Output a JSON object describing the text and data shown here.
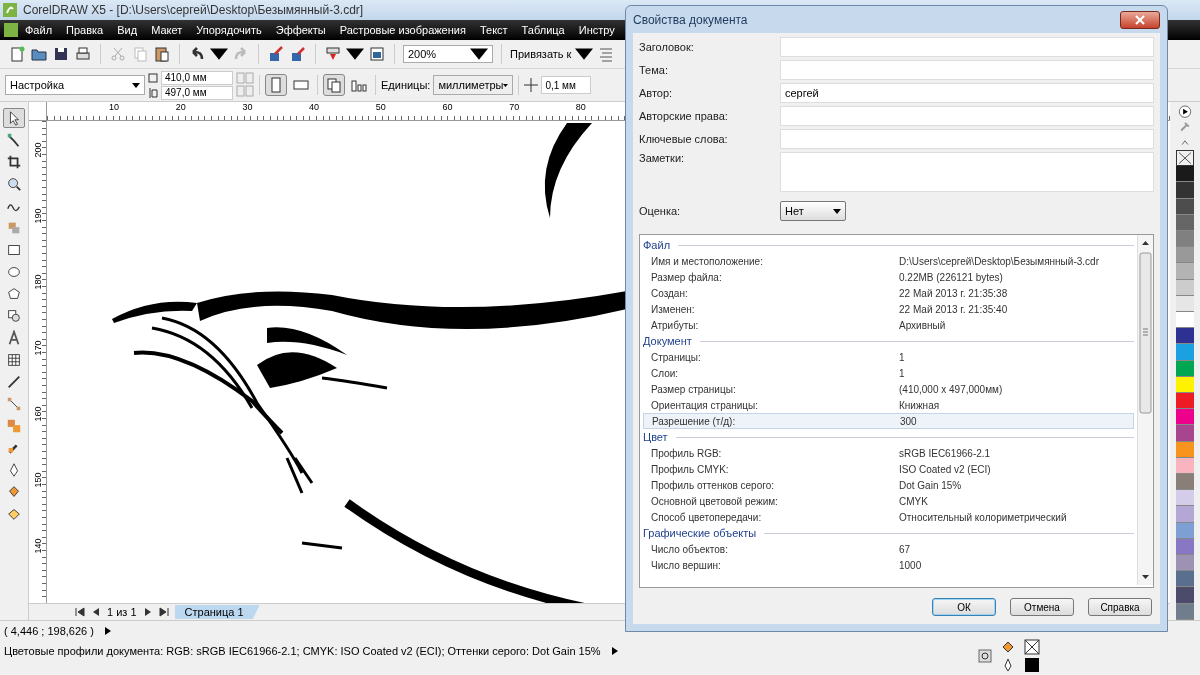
{
  "window": {
    "title": "CorelDRAW X5 - [D:\\Users\\сергей\\Desktop\\Безымянный-3.cdr]"
  },
  "menu": [
    "Файл",
    "Правка",
    "Вид",
    "Макет",
    "Упорядочить",
    "Эффекты",
    "Растровые изображения",
    "Текст",
    "Таблица",
    "Инстру"
  ],
  "toolbar": {
    "zoom": "200%",
    "snap": "Привязать к"
  },
  "property_bar": {
    "preset": "Настройка",
    "width": "410,0 мм",
    "height": "497,0 мм",
    "orientation": [
      {
        "kind": "portrait",
        "selected": true
      },
      {
        "kind": "landscape",
        "selected": false
      }
    ],
    "page_scope": [
      {
        "kind": "all-pages",
        "selected": true
      },
      {
        "kind": "current-page",
        "selected": false
      }
    ],
    "units_label": "Единицы:",
    "units": "миллиметры",
    "nudge": "0,1 мм"
  },
  "toolbox": [
    {
      "kind": "pick",
      "selected": true
    },
    {
      "kind": "shape",
      "selected": false
    },
    {
      "kind": "crop",
      "selected": false
    },
    {
      "kind": "zoom",
      "selected": false
    },
    {
      "kind": "freehand",
      "selected": false
    },
    {
      "kind": "smart",
      "selected": false
    },
    {
      "kind": "rectangle",
      "selected": false
    },
    {
      "kind": "ellipse",
      "selected": false
    },
    {
      "kind": "polygon",
      "selected": false
    },
    {
      "kind": "shapes",
      "selected": false
    },
    {
      "kind": "text",
      "selected": false
    },
    {
      "kind": "table",
      "selected": false
    },
    {
      "kind": "dimension",
      "selected": false
    },
    {
      "kind": "connector",
      "selected": false
    },
    {
      "kind": "blend",
      "selected": false
    },
    {
      "kind": "eyedropper",
      "selected": false
    },
    {
      "kind": "outline",
      "selected": false
    },
    {
      "kind": "fill",
      "selected": false
    },
    {
      "kind": "interactive-fill",
      "selected": false
    }
  ],
  "ruler": {
    "horizontal": [
      "10",
      "20",
      "30",
      "40",
      "50",
      "60",
      "70",
      "80"
    ],
    "vertical": [
      "200",
      "190",
      "180",
      "170",
      "160",
      "150",
      "140"
    ]
  },
  "pages": {
    "counter": "1 из 1",
    "tabs": [
      {
        "label": "Страница 1",
        "selected": true
      }
    ]
  },
  "status_bar": {
    "coordinates": "( 4,446 ; 198,626 )",
    "profiles": "Цветовые профили документа: RGB: sRGB IEC61966-2.1; CMYK: ISO Coated v2 (ECI); Оттенки серого: Dot Gain 15%"
  },
  "palette": [
    {
      "color": "#1a1a1a"
    },
    {
      "color": "#333333"
    },
    {
      "color": "#4d4d4d"
    },
    {
      "color": "#666666"
    },
    {
      "color": "#808080"
    },
    {
      "color": "#999999"
    },
    {
      "color": "#b3b3b3"
    },
    {
      "color": "#cccccc"
    },
    {
      "color": "#e6e6e6"
    },
    {
      "color": "#ffffff"
    },
    {
      "color": "#2e3192"
    },
    {
      "color": "#1ba1e2"
    },
    {
      "color": "#00a651"
    },
    {
      "color": "#fff200"
    },
    {
      "color": "#ed1c24"
    },
    {
      "color": "#ec008c"
    },
    {
      "color": "#a8458f"
    },
    {
      "color": "#f7941d"
    },
    {
      "color": "#f9b4c0"
    },
    {
      "color": "#8a7f78"
    },
    {
      "color": "#d3cdea"
    },
    {
      "color": "#b4a7d6"
    },
    {
      "color": "#7d9fd3"
    },
    {
      "color": "#8878c3"
    },
    {
      "color": "#9e92b4"
    },
    {
      "color": "#5a6f8e"
    },
    {
      "color": "#4c4b6b"
    },
    {
      "color": "#6f7d8c"
    }
  ],
  "dialog": {
    "title": "Свойства документа",
    "fields": [
      {
        "kind": "text",
        "label": "Заголовок:"
      },
      {
        "kind": "text",
        "label": "Тема:"
      },
      {
        "kind": "text",
        "label": "Автор:",
        "value": "сергей"
      },
      {
        "kind": "text",
        "label": "Авторские права:"
      },
      {
        "kind": "text",
        "label": "Ключевые слова:"
      },
      {
        "kind": "multiline",
        "label": "Заметки:"
      },
      {
        "kind": "select",
        "label": "Оценка:",
        "value": "Нет"
      }
    ],
    "sections": [
      {
        "title": "Файл",
        "rows": [
          {
            "label": "Имя и местоположение:",
            "value": "D:\\Users\\сергей\\Desktop\\Безымянный-3.cdr",
            "selected": false
          },
          {
            "label": "Размер файла:",
            "value": "0.22MB (226121 bytes)",
            "selected": false
          },
          {
            "label": "Создан:",
            "value": "22 Май 2013 г.  21:35:38",
            "selected": false
          },
          {
            "label": "Изменен:",
            "value": "22 Май 2013 г.  21:35:40",
            "selected": false
          },
          {
            "label": "Атрибуты:",
            "value": "Архивный",
            "selected": false
          }
        ]
      },
      {
        "title": "Документ",
        "rows": [
          {
            "label": "Страницы:",
            "value": "1",
            "selected": false
          },
          {
            "label": "Слои:",
            "value": "1",
            "selected": false
          },
          {
            "label": "Размер страницы:",
            "value": "(410,000 x 497,000мм)",
            "selected": false
          },
          {
            "label": "Ориентация страницы:",
            "value": "Книжная",
            "selected": false
          },
          {
            "label": "Разрешение (т/д):",
            "value": "300",
            "selected": true
          }
        ]
      },
      {
        "title": "Цвет",
        "rows": [
          {
            "label": "Профиль RGB:",
            "value": "sRGB IEC61966-2.1",
            "selected": false
          },
          {
            "label": "Профиль CMYK:",
            "value": "ISO Coated v2 (ECI)",
            "selected": false
          },
          {
            "label": "Профиль оттенков серого:",
            "value": "Dot Gain 15%",
            "selected": false
          },
          {
            "label": "Основной цветовой режим:",
            "value": "CMYK",
            "selected": false
          },
          {
            "label": "Способ цветопередачи:",
            "value": "Относительный колориметрический",
            "selected": false
          }
        ]
      },
      {
        "title": "Графические объекты",
        "rows": [
          {
            "label": "Число объектов:",
            "value": "67",
            "selected": false
          },
          {
            "label": "Число вершин:",
            "value": "1000",
            "selected": false
          }
        ]
      }
    ],
    "buttons": [
      {
        "label": "ОК",
        "default": true
      },
      {
        "label": "Отмена",
        "default": false
      },
      {
        "label": "Справка",
        "default": false
      }
    ]
  }
}
